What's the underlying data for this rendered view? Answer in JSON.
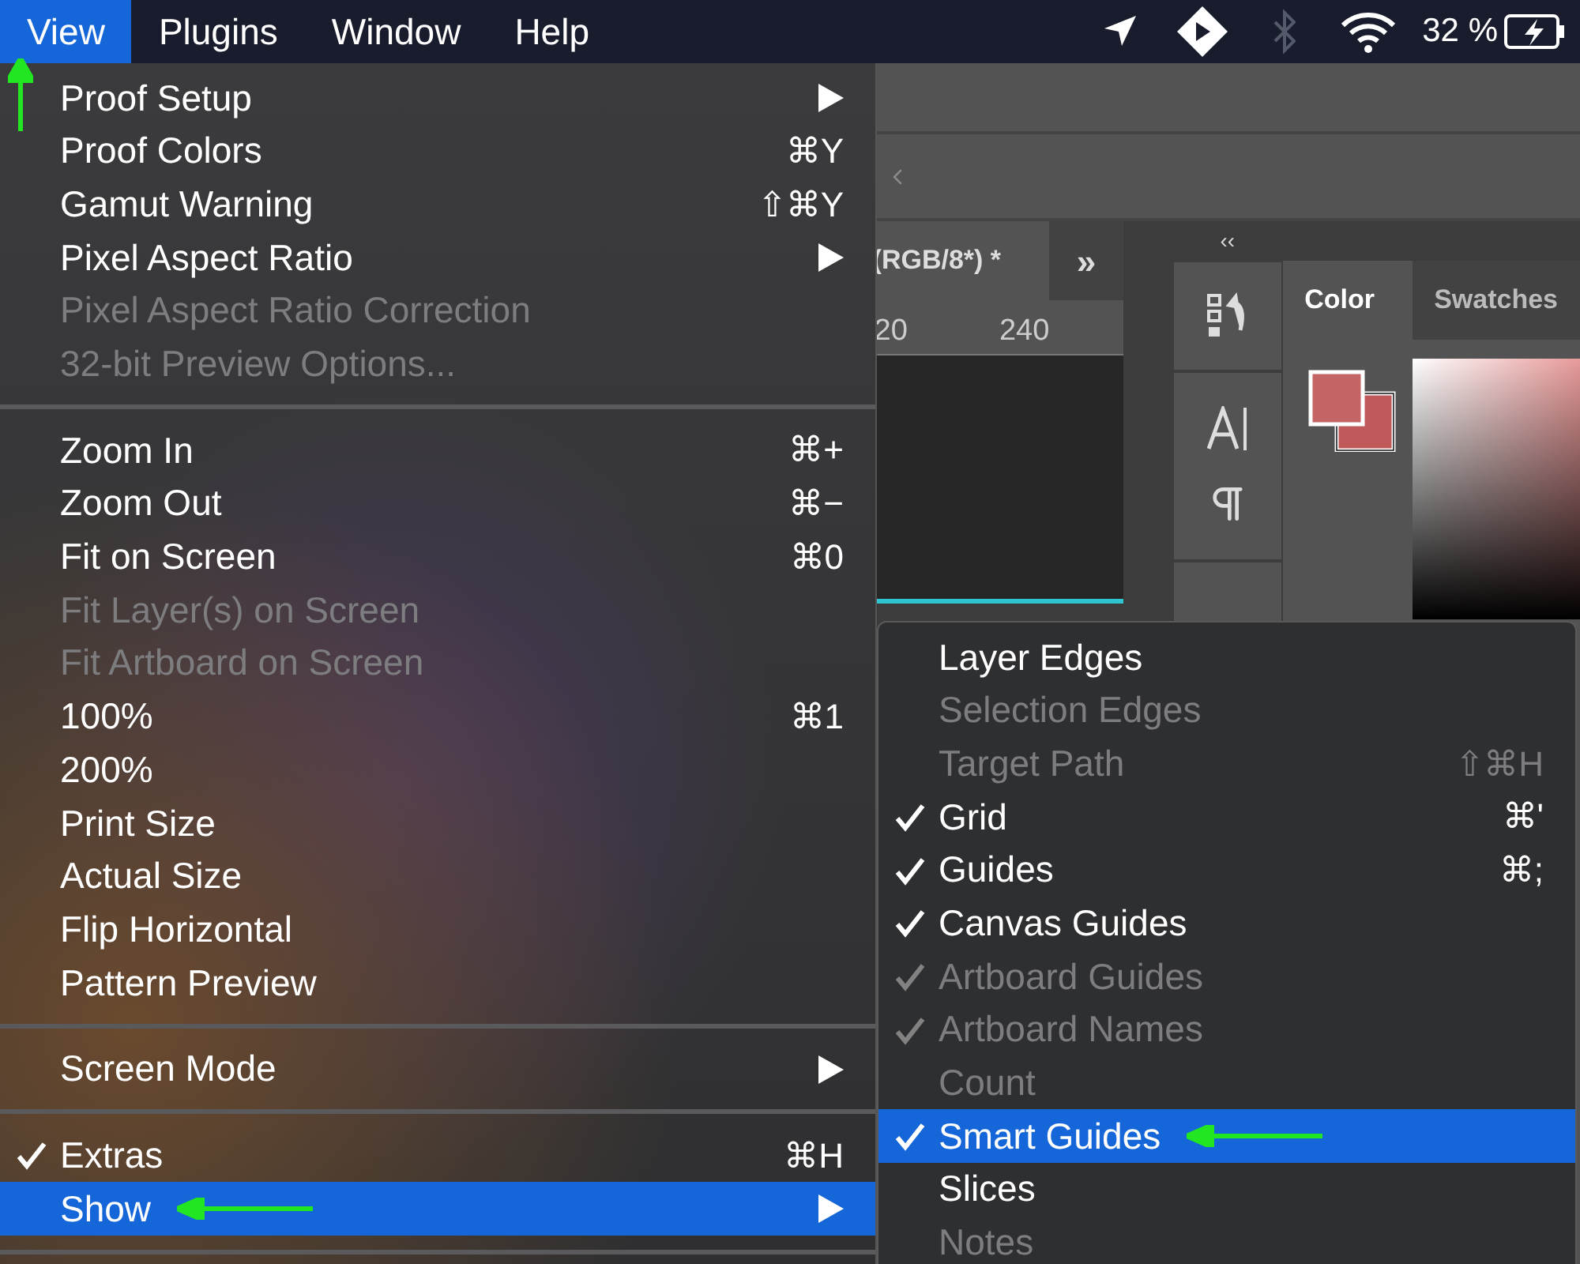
{
  "menu_bar": {
    "items": [
      {
        "label": "View",
        "selected": true,
        "pointer_arrow": true
      },
      {
        "label": "Plugins",
        "selected": false,
        "pointer_arrow": false
      },
      {
        "label": "Window",
        "selected": false,
        "pointer_arrow": false
      },
      {
        "label": "Help",
        "selected": false,
        "pointer_arrow": false
      }
    ],
    "battery_reading": "32 %"
  },
  "workspace": {
    "document_tab": "(RGB/8*) *",
    "tab_overflow": "»",
    "panel_collapse": "‹‹",
    "ruler_labels": [
      "20",
      "240"
    ],
    "panel_tabs": [
      {
        "label": "Color",
        "selected": true
      },
      {
        "label": "Swatches",
        "selected": false
      }
    ]
  },
  "view_menu": {
    "items": [
      {
        "kind": "item",
        "label": "Proof Setup",
        "submenu": true,
        "disabled": false,
        "checked": false,
        "selected": false,
        "pointer_arrow": false
      },
      {
        "kind": "item",
        "label": "Proof Colors",
        "shortcut": "⌘Y",
        "submenu": false,
        "disabled": false,
        "checked": false,
        "selected": false,
        "pointer_arrow": false
      },
      {
        "kind": "item",
        "label": "Gamut Warning",
        "shortcut": "⇧⌘Y",
        "submenu": false,
        "disabled": false,
        "checked": false,
        "selected": false,
        "pointer_arrow": false
      },
      {
        "kind": "item",
        "label": "Pixel Aspect Ratio",
        "submenu": true,
        "disabled": false,
        "checked": false,
        "selected": false,
        "pointer_arrow": false
      },
      {
        "kind": "item",
        "label": "Pixel Aspect Ratio Correction",
        "submenu": false,
        "disabled": true,
        "checked": false,
        "selected": false,
        "pointer_arrow": false
      },
      {
        "kind": "item",
        "label": "32-bit Preview Options...",
        "submenu": false,
        "disabled": true,
        "checked": false,
        "selected": false,
        "pointer_arrow": false
      },
      {
        "kind": "separator"
      },
      {
        "kind": "item",
        "label": "Zoom In",
        "shortcut": "⌘+",
        "submenu": false,
        "disabled": false,
        "checked": false,
        "selected": false,
        "pointer_arrow": false
      },
      {
        "kind": "item",
        "label": "Zoom Out",
        "shortcut": "⌘−",
        "submenu": false,
        "disabled": false,
        "checked": false,
        "selected": false,
        "pointer_arrow": false
      },
      {
        "kind": "item",
        "label": "Fit on Screen",
        "shortcut": "⌘0",
        "submenu": false,
        "disabled": false,
        "checked": false,
        "selected": false,
        "pointer_arrow": false
      },
      {
        "kind": "item",
        "label": "Fit Layer(s) on Screen",
        "submenu": false,
        "disabled": true,
        "checked": false,
        "selected": false,
        "pointer_arrow": false
      },
      {
        "kind": "item",
        "label": "Fit Artboard on Screen",
        "submenu": false,
        "disabled": true,
        "checked": false,
        "selected": false,
        "pointer_arrow": false
      },
      {
        "kind": "item",
        "label": "100%",
        "shortcut": "⌘1",
        "submenu": false,
        "disabled": false,
        "checked": false,
        "selected": false,
        "pointer_arrow": false
      },
      {
        "kind": "item",
        "label": "200%",
        "submenu": false,
        "disabled": false,
        "checked": false,
        "selected": false,
        "pointer_arrow": false
      },
      {
        "kind": "item",
        "label": "Print Size",
        "submenu": false,
        "disabled": false,
        "checked": false,
        "selected": false,
        "pointer_arrow": false
      },
      {
        "kind": "item",
        "label": "Actual Size",
        "submenu": false,
        "disabled": false,
        "checked": false,
        "selected": false,
        "pointer_arrow": false
      },
      {
        "kind": "item",
        "label": "Flip Horizontal",
        "submenu": false,
        "disabled": false,
        "checked": false,
        "selected": false,
        "pointer_arrow": false
      },
      {
        "kind": "item",
        "label": "Pattern Preview",
        "submenu": false,
        "disabled": false,
        "checked": false,
        "selected": false,
        "pointer_arrow": false
      },
      {
        "kind": "separator"
      },
      {
        "kind": "item",
        "label": "Screen Mode",
        "submenu": true,
        "disabled": false,
        "checked": false,
        "selected": false,
        "pointer_arrow": false
      },
      {
        "kind": "separator"
      },
      {
        "kind": "item",
        "label": "Extras",
        "shortcut": "⌘H",
        "submenu": false,
        "disabled": false,
        "checked": true,
        "selected": false,
        "pointer_arrow": false
      },
      {
        "kind": "item",
        "label": "Show",
        "submenu": true,
        "disabled": false,
        "checked": false,
        "selected": true,
        "pointer_arrow": true
      },
      {
        "kind": "separator"
      }
    ]
  },
  "show_submenu": {
    "items": [
      {
        "kind": "item",
        "label": "Layer Edges",
        "disabled": false,
        "checked": false,
        "selected": false,
        "pointer_arrow": false
      },
      {
        "kind": "item",
        "label": "Selection Edges",
        "disabled": true,
        "checked": false,
        "selected": false,
        "pointer_arrow": false
      },
      {
        "kind": "item",
        "label": "Target Path",
        "shortcut": "⇧⌘H",
        "disabled": true,
        "checked": false,
        "selected": false,
        "pointer_arrow": false
      },
      {
        "kind": "item",
        "label": "Grid",
        "shortcut": "⌘'",
        "disabled": false,
        "checked": true,
        "selected": false,
        "pointer_arrow": false
      },
      {
        "kind": "item",
        "label": "Guides",
        "shortcut": "⌘;",
        "disabled": false,
        "checked": true,
        "selected": false,
        "pointer_arrow": false
      },
      {
        "kind": "item",
        "label": "Canvas Guides",
        "disabled": false,
        "checked": true,
        "selected": false,
        "pointer_arrow": false
      },
      {
        "kind": "item",
        "label": "Artboard Guides",
        "disabled": true,
        "checked": true,
        "selected": false,
        "pointer_arrow": false
      },
      {
        "kind": "item",
        "label": "Artboard Names",
        "disabled": true,
        "checked": true,
        "selected": false,
        "pointer_arrow": false
      },
      {
        "kind": "item",
        "label": "Count",
        "disabled": true,
        "checked": false,
        "selected": false,
        "pointer_arrow": false
      },
      {
        "kind": "item",
        "label": "Smart Guides",
        "disabled": false,
        "checked": true,
        "selected": true,
        "pointer_arrow": true
      },
      {
        "kind": "item",
        "label": "Slices",
        "disabled": false,
        "checked": false,
        "selected": false,
        "pointer_arrow": false
      },
      {
        "kind": "item",
        "label": "Notes",
        "disabled": true,
        "checked": false,
        "selected": false,
        "pointer_arrow": false
      }
    ]
  }
}
